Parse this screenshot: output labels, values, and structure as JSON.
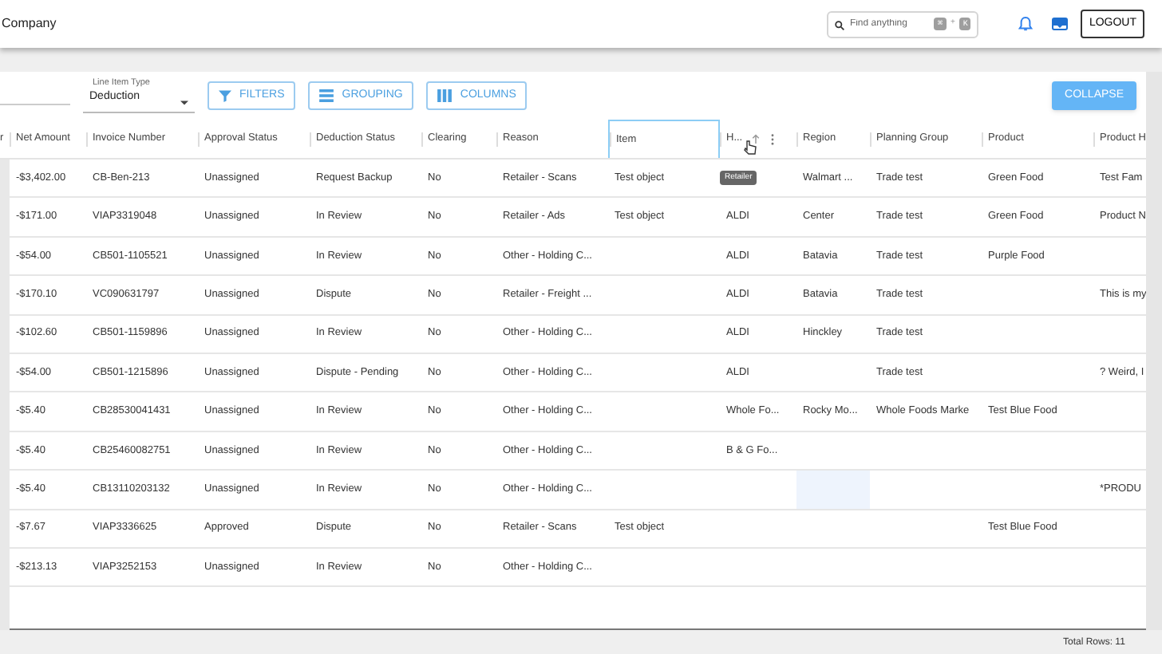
{
  "header": {
    "company": "Company",
    "search": {
      "placeholder": "Find anything",
      "keys": [
        "⌘",
        "+",
        "K"
      ]
    },
    "logout": "LOGOUT"
  },
  "toolbar": {
    "line_item_type": {
      "label": "Line Item Type",
      "value": "Deduction"
    },
    "buttons": [
      {
        "kind": "filter",
        "label": "FILTERS"
      },
      {
        "kind": "grouping",
        "label": "GROUPING"
      },
      {
        "kind": "columns",
        "label": "COLUMNS"
      }
    ],
    "collapse": "COLLAPSE"
  },
  "table": {
    "columns": [
      {
        "label": "r",
        "selected": false
      },
      {
        "label": "Net Amount",
        "selected": false
      },
      {
        "label": "Invoice Number",
        "selected": false
      },
      {
        "label": "Approval Status",
        "selected": false
      },
      {
        "label": "Deduction Status",
        "selected": false
      },
      {
        "label": "Clearing",
        "selected": false
      },
      {
        "label": "Reason",
        "selected": false
      },
      {
        "label": "Item",
        "selected": true
      },
      {
        "label": "H...",
        "selected": false,
        "sorted": true,
        "menu": true
      },
      {
        "label": "Region",
        "selected": false
      },
      {
        "label": "Planning Group",
        "selected": false
      },
      {
        "label": "Product",
        "selected": false
      },
      {
        "label": "Product H",
        "selected": false
      }
    ],
    "rows": [
      {
        "cells": [
          null,
          "-$3,402.00",
          "CB-Ben-213",
          "Unassigned",
          "Request Backup",
          "No",
          "Retailer - Scans",
          "Test object",
          {
            "tooltip": "Retailer"
          },
          "Walmart ...",
          "Trade test",
          "Green Food",
          "Test Fam"
        ]
      },
      {
        "cells": [
          null,
          "-$171.00",
          "VIAP3319048",
          "Unassigned",
          "In Review",
          "No",
          "Retailer - Ads",
          "Test object",
          "ALDI",
          "Center",
          "Trade test",
          "Green Food",
          "Product N"
        ]
      },
      {
        "cells": [
          null,
          "-$54.00",
          "CB501-1105521",
          "Unassigned",
          "In Review",
          "No",
          "Other - Holding C...",
          null,
          "ALDI",
          "Batavia",
          "Trade test",
          "Purple Food",
          null
        ]
      },
      {
        "cells": [
          null,
          "-$170.10",
          "VC090631797",
          "Unassigned",
          "Dispute",
          "No",
          "Retailer - Freight ...",
          null,
          "ALDI",
          "Batavia",
          "Trade test",
          null,
          "This is my"
        ]
      },
      {
        "cells": [
          null,
          "-$102.60",
          "CB501-1159896",
          "Unassigned",
          "In Review",
          "No",
          "Other - Holding C...",
          null,
          "ALDI",
          "Hinckley",
          "Trade test",
          null,
          null
        ]
      },
      {
        "cells": [
          null,
          "-$54.00",
          "CB501-1215896",
          "Unassigned",
          "Dispute - Pending",
          "No",
          "Other - Holding C...",
          null,
          "ALDI",
          null,
          "Trade test",
          null,
          "? Weird, I"
        ]
      },
      {
        "cells": [
          null,
          "-$5.40",
          "CB28530041431",
          "Unassigned",
          "In Review",
          "No",
          "Other - Holding C...",
          null,
          "Whole Fo...",
          "Rocky Mo...",
          "Whole Foods Marke",
          "Test Blue Food",
          null
        ]
      },
      {
        "cells": [
          null,
          "-$5.40",
          "CB25460082751",
          "Unassigned",
          "In Review",
          "No",
          "Other - Holding C...",
          null,
          "B & G Fo...",
          null,
          null,
          null,
          null
        ]
      },
      {
        "cells": [
          null,
          "-$5.40",
          "CB13110203132",
          "Unassigned",
          "In Review",
          "No",
          "Other - Holding C...",
          null,
          null,
          {
            "selected": true
          },
          null,
          null,
          "*PRODU"
        ]
      },
      {
        "cells": [
          null,
          "-$7.67",
          "VIAP3336625",
          "Approved",
          "Dispute",
          "No",
          "Retailer - Scans",
          "Test object",
          null,
          null,
          null,
          "Test Blue Food",
          null
        ]
      },
      {
        "cells": [
          null,
          "-$213.13",
          "VIAP3252153",
          "Unassigned",
          "In Review",
          "No",
          "Other - Holding C...",
          null,
          null,
          null,
          null,
          null,
          null
        ]
      }
    ]
  },
  "footer": {
    "total_rows": "Total Rows: 11"
  }
}
